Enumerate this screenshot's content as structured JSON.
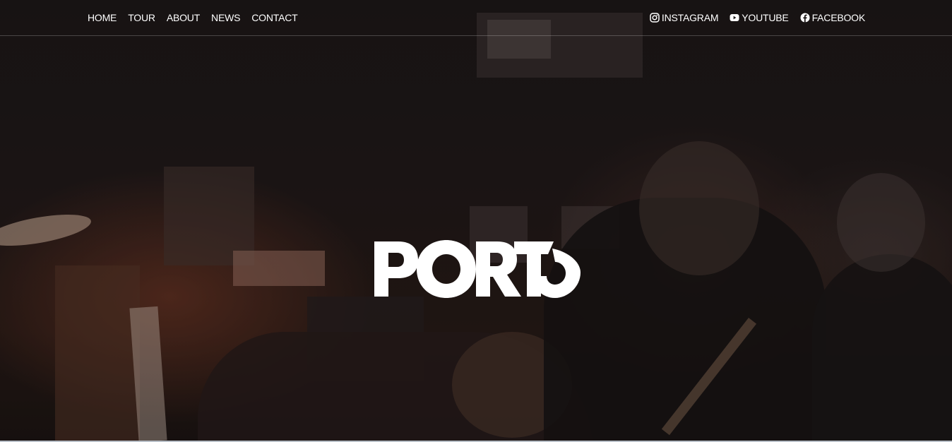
{
  "nav": {
    "left": [
      {
        "label": "HOME"
      },
      {
        "label": "TOUR"
      },
      {
        "label": "ABOUT"
      },
      {
        "label": "NEWS"
      },
      {
        "label": "CONTACT"
      }
    ],
    "right": [
      {
        "label": "INSTAGRAM",
        "icon": "instagram-icon"
      },
      {
        "label": "YOUTUBE",
        "icon": "youtube-icon"
      },
      {
        "label": "FACEBOOK",
        "icon": "facebook-icon"
      }
    ]
  },
  "hero": {
    "logo_text": "PORTO"
  },
  "colors": {
    "text": "#ffffff",
    "background": "#1f1a1a"
  }
}
